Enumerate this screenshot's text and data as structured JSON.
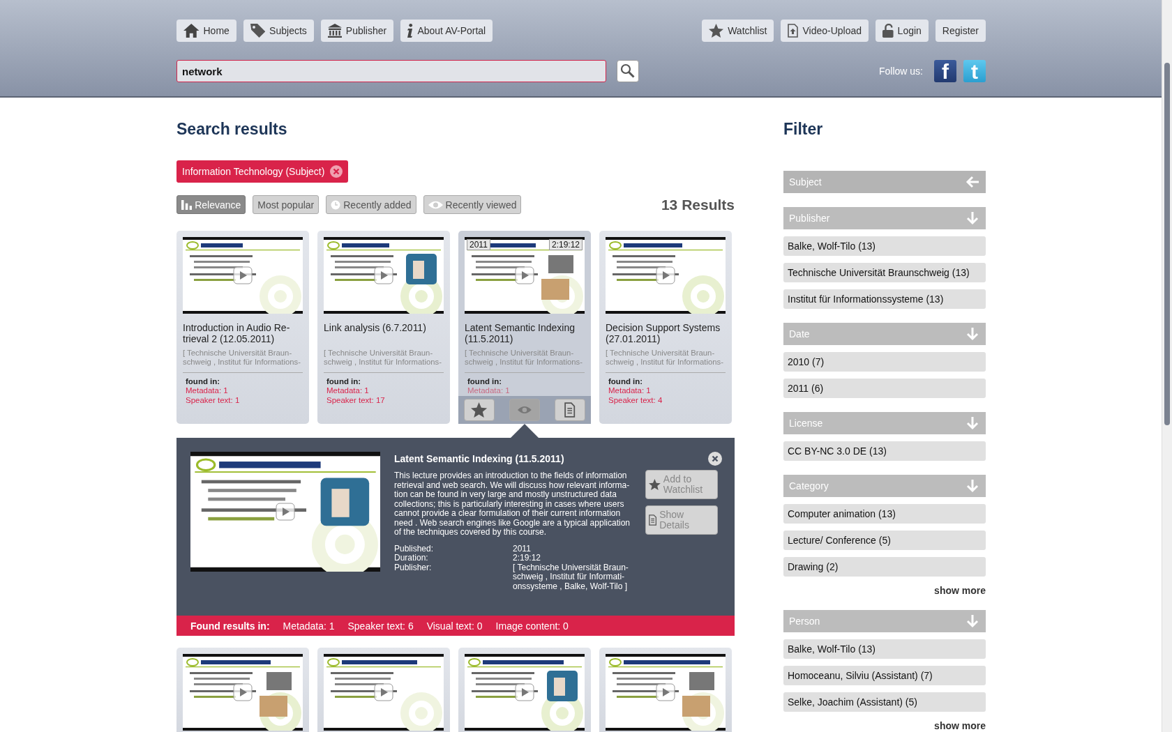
{
  "nav": {
    "left": [
      {
        "label": "Home"
      },
      {
        "label": "Subjects"
      },
      {
        "label": "Publisher"
      },
      {
        "label": "About AV-Portal"
      }
    ],
    "right": [
      {
        "label": "Watchlist"
      },
      {
        "label": "Video-Upload"
      },
      {
        "label": "Login"
      },
      {
        "label": "Register"
      }
    ]
  },
  "search": {
    "value": "network"
  },
  "follow": {
    "label": "Follow us:",
    "links": [
      {
        "kind": "facebook",
        "label": "f"
      },
      {
        "kind": "twitter",
        "label": "t"
      }
    ]
  },
  "results": {
    "title": "Search results",
    "active_filters": [
      {
        "label": "Information Technology (Subject)"
      }
    ],
    "sort": [
      {
        "label": "Relevance",
        "selected": true
      },
      {
        "label": "Most popular",
        "selected": false
      },
      {
        "label": "Recently added",
        "selected": false
      },
      {
        "label": "Recently viewed",
        "selected": false
      }
    ],
    "count": "13 Results"
  },
  "cards": [
    {
      "title": "Introduction in Audio Re-trieval 2 (12.05.2011)",
      "publisher": "[ Technische Universität Braun-schweig , Institut für Informations-",
      "found_label": "found in:",
      "found_in": [
        "Metadata:  1",
        "Speaker text:  1"
      ],
      "hovered": false
    },
    {
      "title": "Link analysis (6.7.2011)",
      "publisher": "[ Technische Universität Braun-schweig , Institut für Informations-",
      "found_label": "found in:",
      "found_in": [
        "Metadata:  1",
        "Speaker text:  17"
      ],
      "hovered": false
    },
    {
      "title": "Latent Semantic Indexing (11.5.2011)",
      "publisher": "[ Technische Universität Braun-schweig , Institut für Informations-",
      "found_label": "found in:",
      "found_in": [
        "Metadata:  1"
      ],
      "hovered": true,
      "year": "2011",
      "duration": "2:19:12"
    },
    {
      "title": "Decision Support Systems (27.01.2011)",
      "publisher": "[ Technische Universität Braun-schweig , Institut für Informations-",
      "found_label": "found in:",
      "found_in": [
        "Metadata:  1",
        "Speaker text:  4"
      ],
      "hovered": false
    }
  ],
  "detail": {
    "title": "Latent Semantic Indexing (11.5.2011)",
    "description": "This lecture provides an introduction to the fields of information retrieval and web search. We will discuss how relevant informa-tion can be found in very large and mostly unstructured data collections; this is particularly interesting in cases where users cannot provide a clear formulation of their current information need . Web search engines like Google are a typical application of the techniques covered by this course.",
    "meta": [
      {
        "label": "Published:",
        "value": "2011"
      },
      {
        "label": "Duration:",
        "value": "2:19:12"
      },
      {
        "label": "Publisher:",
        "value": "[ Technische Universität Braun-schweig , Institut für Informati-onssysteme , Balke, Wolf-Tilo ]"
      }
    ],
    "buttons": [
      {
        "label": "Add to Watchlist"
      },
      {
        "label": "Show Details"
      }
    ],
    "found_label": "Found results in:",
    "found_in": [
      "Metadata: 1",
      "Speaker text: 6",
      "Visual text: 0",
      "Image content: 0"
    ]
  },
  "filter": {
    "title": "Filter",
    "sections": [
      {
        "label": "Subject",
        "active": true
      },
      {
        "label": "Publisher",
        "active": false,
        "items": [
          "Balke, Wolf-Tilo (13)",
          "Technische Universität Braunschweig (13)",
          "Institut für Informationssysteme (13)"
        ]
      },
      {
        "label": "Date",
        "active": false,
        "items": [
          "2010 (7)",
          "2011 (6)"
        ]
      },
      {
        "label": "License",
        "active": false,
        "items": [
          "CC BY-NC 3.0 DE (13)"
        ]
      },
      {
        "label": "Category",
        "active": false,
        "items": [
          "Computer animation (13)",
          "Lecture/ Conference (5)",
          "Drawing (2)"
        ],
        "show_more": "show more"
      },
      {
        "label": "Person",
        "active": false,
        "items": [
          "Balke, Wolf-Tilo (13)",
          "Homoceanu, Silviu (Assistant) (7)",
          "Selke, Joachim (Assistant) (5)"
        ],
        "show_more": "show more"
      }
    ]
  }
}
